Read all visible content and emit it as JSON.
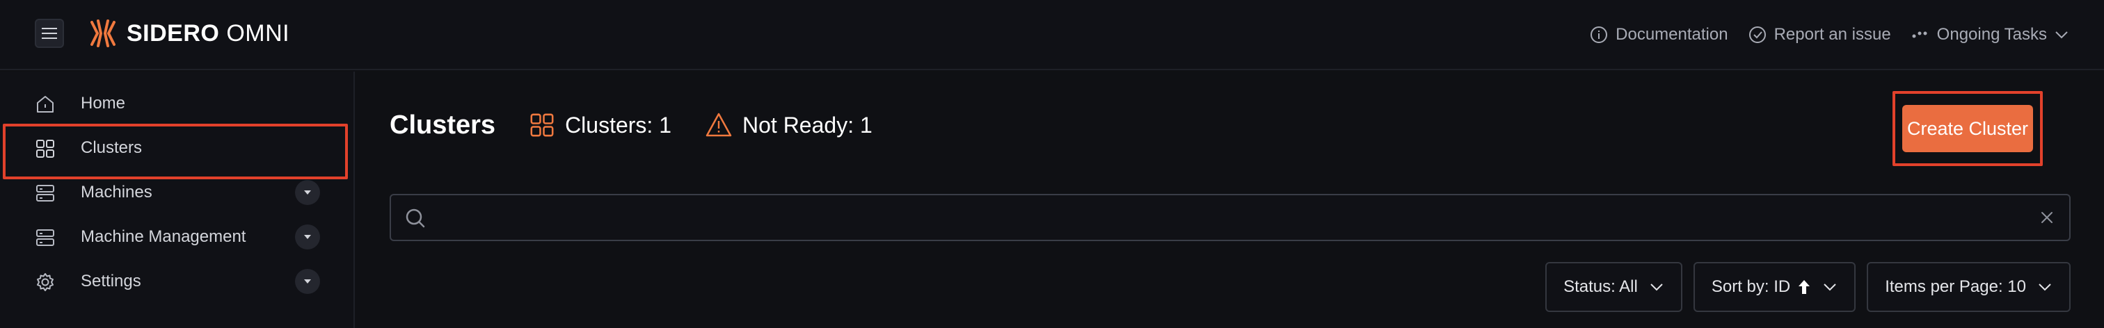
{
  "header": {
    "brand_bold": "SIDERO",
    "brand_light": "OMNI",
    "links": [
      {
        "label": "Documentation",
        "icon": "info-icon"
      },
      {
        "label": "Report an issue",
        "icon": "check-circle-icon"
      },
      {
        "label": "Ongoing Tasks",
        "icon": "tasks-dots-icon"
      }
    ]
  },
  "sidebar": {
    "items": [
      {
        "label": "Home",
        "icon": "home-icon"
      },
      {
        "label": "Clusters",
        "icon": "grid-icon"
      },
      {
        "label": "Machines",
        "icon": "server-icon"
      },
      {
        "label": "Machine Management",
        "icon": "server-icon"
      },
      {
        "label": "Settings",
        "icon": "gear-icon"
      }
    ]
  },
  "main": {
    "title": "Clusters",
    "clusters_stat": "Clusters: 1",
    "not_ready_stat": "Not Ready: 1",
    "create_button": "Create Cluster",
    "search_value": "",
    "filters": {
      "status": "Status: All",
      "sort": "Sort by: ID",
      "items_per_page": "Items per Page: 10"
    }
  },
  "colors": {
    "accent": "#ea6d40",
    "highlight_border": "#e2412b",
    "background": "#0f1014",
    "warning": "#f0793f"
  }
}
